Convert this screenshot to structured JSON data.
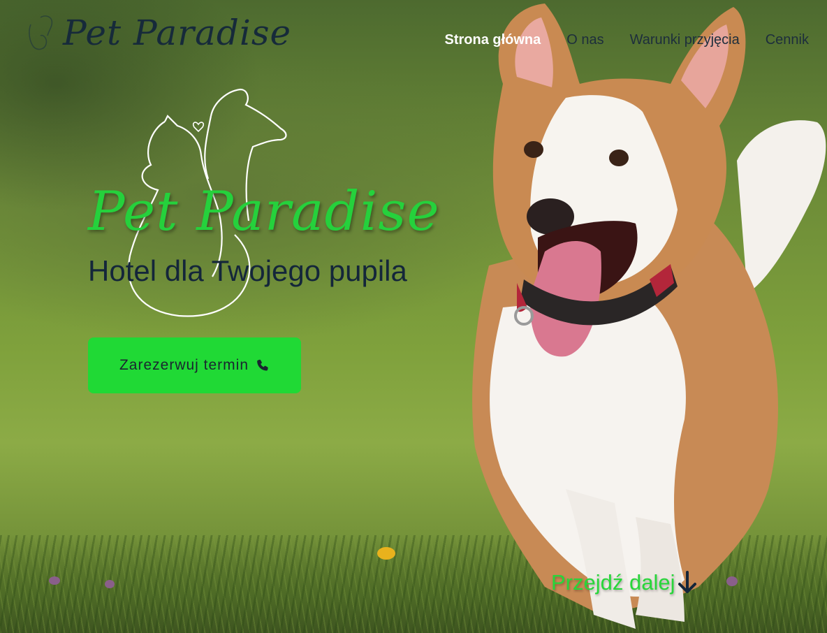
{
  "header": {
    "logo_text": "Pet Paradise",
    "nav": [
      {
        "label": "Strona główna",
        "active": true
      },
      {
        "label": "O nas",
        "active": false
      },
      {
        "label": "Warunki przyjęcia",
        "active": false
      },
      {
        "label": "Cennik",
        "active": false
      }
    ]
  },
  "hero": {
    "title": "Pet Paradise",
    "subtitle": "Hotel dla Twojego pupila",
    "cta_label": "Zarezerwuj termin",
    "cta_icon": "phone-icon",
    "scroll_label": "Przejdź dalej",
    "scroll_icon": "arrow-down-icon"
  },
  "colors": {
    "accent_green": "#20d935",
    "title_green": "#25d13c",
    "dark_navy": "#14263a"
  }
}
